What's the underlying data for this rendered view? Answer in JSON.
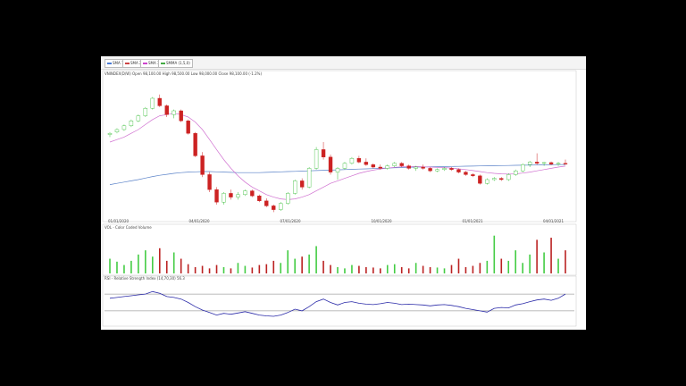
{
  "legend": [
    {
      "label": "SMA 1",
      "color": "#4a7bd4"
    },
    {
      "label": "SMA 2",
      "color": "#cc4444"
    },
    {
      "label": "SMA 3",
      "color": "#cc44cc"
    },
    {
      "label": "SMMA (1,5,0)",
      "color": "#44aa44"
    }
  ],
  "price_header": "VNINDEX(D/W)  Open 98,100.00  High 98,500.00  Low 98,000.00  Close 98,100.00  (-1.2%)",
  "volume_header": "VOL - Color Coded Volume",
  "rsi_header": "RSI - Relative Strength Index (14,70,30) 56.3",
  "date_labels": [
    "01/01/2020",
    "04/01/2020",
    "07/01/2020",
    "10/01/2020",
    "01/01/2021",
    "04/01/2021"
  ],
  "chart_data": {
    "type": "candlestick",
    "price_ylim": [
      80,
      135
    ],
    "candles": [
      {
        "o": 113.0,
        "h": 114.0,
        "l": 112.0,
        "c": 113.5
      },
      {
        "o": 114.0,
        "h": 115.5,
        "l": 113.5,
        "c": 115.0
      },
      {
        "o": 115.0,
        "h": 117.0,
        "l": 114.5,
        "c": 116.5
      },
      {
        "o": 116.5,
        "h": 119.0,
        "l": 116.0,
        "c": 118.5
      },
      {
        "o": 118.5,
        "h": 121.0,
        "l": 118.0,
        "c": 120.5
      },
      {
        "o": 120.5,
        "h": 124.0,
        "l": 120.0,
        "c": 123.5
      },
      {
        "o": 123.5,
        "h": 128.0,
        "l": 123.0,
        "c": 127.5
      },
      {
        "o": 127.5,
        "h": 129.0,
        "l": 124.0,
        "c": 124.5
      },
      {
        "o": 124.5,
        "h": 125.0,
        "l": 120.0,
        "c": 121.0
      },
      {
        "o": 121.0,
        "h": 123.0,
        "l": 119.5,
        "c": 122.5
      },
      {
        "o": 122.5,
        "h": 123.0,
        "l": 118.0,
        "c": 118.5
      },
      {
        "o": 118.5,
        "h": 119.0,
        "l": 113.0,
        "c": 113.5
      },
      {
        "o": 113.5,
        "h": 114.0,
        "l": 104.0,
        "c": 104.5
      },
      {
        "o": 104.5,
        "h": 106.0,
        "l": 96.0,
        "c": 97.0
      },
      {
        "o": 97.0,
        "h": 98.0,
        "l": 90.0,
        "c": 91.0
      },
      {
        "o": 91.0,
        "h": 92.0,
        "l": 85.0,
        "c": 86.0
      },
      {
        "o": 86.0,
        "h": 90.0,
        "l": 85.0,
        "c": 89.5
      },
      {
        "o": 89.5,
        "h": 91.0,
        "l": 87.0,
        "c": 88.0
      },
      {
        "o": 88.0,
        "h": 90.0,
        "l": 87.0,
        "c": 89.0
      },
      {
        "o": 89.0,
        "h": 91.0,
        "l": 88.5,
        "c": 90.5
      },
      {
        "o": 90.5,
        "h": 91.0,
        "l": 88.0,
        "c": 88.5
      },
      {
        "o": 88.5,
        "h": 89.0,
        "l": 86.0,
        "c": 86.5
      },
      {
        "o": 86.5,
        "h": 87.5,
        "l": 84.0,
        "c": 84.5
      },
      {
        "o": 84.5,
        "h": 85.0,
        "l": 82.0,
        "c": 83.0
      },
      {
        "o": 83.0,
        "h": 86.0,
        "l": 82.5,
        "c": 85.5
      },
      {
        "o": 85.5,
        "h": 90.0,
        "l": 85.0,
        "c": 89.5
      },
      {
        "o": 89.5,
        "h": 95.0,
        "l": 89.0,
        "c": 94.5
      },
      {
        "o": 94.5,
        "h": 95.5,
        "l": 91.0,
        "c": 92.0
      },
      {
        "o": 92.0,
        "h": 100.0,
        "l": 91.5,
        "c": 99.5
      },
      {
        "o": 99.5,
        "h": 108.0,
        "l": 99.0,
        "c": 107.0
      },
      {
        "o": 107.0,
        "h": 110.0,
        "l": 103.0,
        "c": 104.0
      },
      {
        "o": 104.0,
        "h": 105.0,
        "l": 97.0,
        "c": 98.0
      },
      {
        "o": 98.0,
        "h": 100.0,
        "l": 95.0,
        "c": 99.5
      },
      {
        "o": 99.5,
        "h": 102.0,
        "l": 99.0,
        "c": 101.5
      },
      {
        "o": 101.5,
        "h": 104.0,
        "l": 101.0,
        "c": 103.5
      },
      {
        "o": 103.5,
        "h": 104.5,
        "l": 101.5,
        "c": 102.0
      },
      {
        "o": 102.0,
        "h": 103.5,
        "l": 100.5,
        "c": 101.0
      },
      {
        "o": 101.0,
        "h": 101.5,
        "l": 99.5,
        "c": 100.0
      },
      {
        "o": 100.0,
        "h": 101.0,
        "l": 99.0,
        "c": 99.5
      },
      {
        "o": 99.5,
        "h": 101.0,
        "l": 99.0,
        "c": 100.5
      },
      {
        "o": 100.5,
        "h": 102.0,
        "l": 100.0,
        "c": 101.5
      },
      {
        "o": 101.5,
        "h": 102.0,
        "l": 100.0,
        "c": 100.5
      },
      {
        "o": 100.5,
        "h": 101.0,
        "l": 99.0,
        "c": 99.5
      },
      {
        "o": 99.5,
        "h": 100.5,
        "l": 98.5,
        "c": 100.0
      },
      {
        "o": 100.0,
        "h": 101.0,
        "l": 99.0,
        "c": 99.5
      },
      {
        "o": 99.5,
        "h": 100.0,
        "l": 98.0,
        "c": 98.5
      },
      {
        "o": 98.5,
        "h": 99.5,
        "l": 98.0,
        "c": 99.0
      },
      {
        "o": 99.0,
        "h": 100.0,
        "l": 98.5,
        "c": 99.5
      },
      {
        "o": 99.5,
        "h": 100.0,
        "l": 98.5,
        "c": 99.0
      },
      {
        "o": 99.0,
        "h": 99.5,
        "l": 97.5,
        "c": 98.0
      },
      {
        "o": 98.0,
        "h": 98.5,
        "l": 96.5,
        "c": 97.0
      },
      {
        "o": 97.0,
        "h": 97.5,
        "l": 96.0,
        "c": 96.5
      },
      {
        "o": 96.5,
        "h": 97.0,
        "l": 93.0,
        "c": 93.5
      },
      {
        "o": 93.5,
        "h": 95.5,
        "l": 93.0,
        "c": 95.0
      },
      {
        "o": 95.0,
        "h": 96.0,
        "l": 94.5,
        "c": 95.5
      },
      {
        "o": 95.5,
        "h": 96.0,
        "l": 94.5,
        "c": 95.0
      },
      {
        "o": 95.0,
        "h": 97.5,
        "l": 94.5,
        "c": 97.0
      },
      {
        "o": 97.0,
        "h": 99.0,
        "l": 96.5,
        "c": 98.5
      },
      {
        "o": 98.5,
        "h": 101.5,
        "l": 98.0,
        "c": 101.0
      },
      {
        "o": 101.0,
        "h": 102.5,
        "l": 100.0,
        "c": 102.0
      },
      {
        "o": 102.0,
        "h": 105.5,
        "l": 101.0,
        "c": 101.5
      },
      {
        "o": 101.5,
        "h": 102.0,
        "l": 100.5,
        "c": 101.8
      },
      {
        "o": 101.8,
        "h": 102.2,
        "l": 100.8,
        "c": 101.2
      },
      {
        "o": 101.2,
        "h": 102.0,
        "l": 100.5,
        "c": 101.5
      },
      {
        "o": 101.5,
        "h": 103.0,
        "l": 101.0,
        "c": 101.2
      }
    ],
    "volume": [
      0.35,
      0.28,
      0.2,
      0.3,
      0.45,
      0.55,
      0.4,
      0.6,
      0.3,
      0.5,
      0.35,
      0.22,
      0.15,
      0.18,
      0.12,
      0.2,
      0.15,
      0.12,
      0.25,
      0.18,
      0.14,
      0.2,
      0.22,
      0.3,
      0.25,
      0.55,
      0.35,
      0.4,
      0.45,
      0.65,
      0.3,
      0.2,
      0.15,
      0.12,
      0.2,
      0.18,
      0.15,
      0.14,
      0.12,
      0.2,
      0.22,
      0.15,
      0.12,
      0.25,
      0.18,
      0.15,
      0.14,
      0.12,
      0.2,
      0.35,
      0.15,
      0.18,
      0.25,
      0.3,
      0.9,
      0.35,
      0.3,
      0.55,
      0.25,
      0.45,
      0.8,
      0.5,
      0.85,
      0.35,
      0.55
    ],
    "volume_ylim": [
      0,
      1
    ],
    "rsi": [
      60,
      62,
      64,
      66,
      68,
      70,
      76,
      72,
      64,
      62,
      58,
      50,
      40,
      32,
      26,
      20,
      24,
      22,
      25,
      28,
      24,
      20,
      18,
      17,
      20,
      26,
      34,
      30,
      40,
      52,
      58,
      50,
      44,
      50,
      52,
      48,
      46,
      45,
      47,
      50,
      48,
      45,
      46,
      45,
      44,
      42,
      44,
      45,
      43,
      40,
      36,
      33,
      30,
      27,
      36,
      38,
      37,
      44,
      47,
      52,
      56,
      58,
      55,
      60,
      70
    ],
    "rsi_ylim": [
      0,
      100
    ],
    "rsi_levels": [
      30,
      70
    ],
    "sma_short": [
      110,
      111,
      112,
      113.5,
      115,
      117,
      119,
      120.5,
      121,
      121.5,
      121,
      120,
      118,
      115,
      111,
      107,
      103,
      99.5,
      96.5,
      94,
      92,
      90.5,
      89,
      88,
      87.3,
      87,
      87.3,
      88,
      89,
      90.5,
      92,
      93.5,
      94.5,
      95.5,
      96.5,
      97.5,
      98.2,
      98.8,
      99.2,
      99.6,
      99.9,
      100.1,
      100.2,
      100.2,
      100.1,
      100,
      99.9,
      99.8,
      99.6,
      99.3,
      99,
      98.6,
      98.2,
      97.8,
      97.5,
      97.3,
      97.2,
      97.3,
      97.6,
      98,
      98.5,
      99,
      99.5,
      100,
      100.4
    ],
    "sma_long": [
      93,
      93.5,
      94,
      94.5,
      95,
      95.6,
      96.2,
      96.7,
      97.1,
      97.5,
      97.8,
      98,
      98.1,
      98.2,
      98.2,
      98.1,
      98,
      97.9,
      97.8,
      97.8,
      97.8,
      97.8,
      97.9,
      98,
      98.1,
      98.2,
      98.3,
      98.4,
      98.5,
      98.6,
      98.7,
      98.8,
      98.9,
      99,
      99.1,
      99.2,
      99.3,
      99.4,
      99.5,
      99.6,
      99.7,
      99.8,
      99.9,
      100,
      100.05,
      100.1,
      100.15,
      100.2,
      100.25,
      100.3,
      100.35,
      100.4,
      100.45,
      100.5,
      100.55,
      100.6,
      100.65,
      100.7,
      100.75,
      100.8,
      100.85,
      100.9,
      100.95,
      101,
      101.05
    ]
  }
}
